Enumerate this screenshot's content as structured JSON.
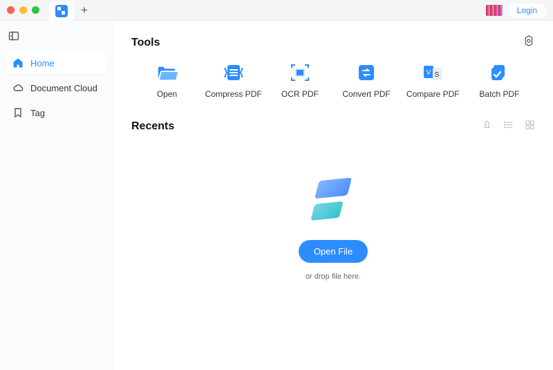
{
  "titlebar": {
    "login_label": "Login"
  },
  "sidebar": {
    "items": [
      {
        "label": "Home"
      },
      {
        "label": "Document Cloud"
      },
      {
        "label": "Tag"
      }
    ]
  },
  "sections": {
    "tools_title": "Tools",
    "recents_title": "Recents"
  },
  "tools": [
    {
      "label": "Open"
    },
    {
      "label": "Compress PDF"
    },
    {
      "label": "OCR PDF"
    },
    {
      "label": "Convert PDF"
    },
    {
      "label": "Compare PDF"
    },
    {
      "label": "Batch PDF"
    }
  ],
  "empty_state": {
    "open_button": "Open File",
    "hint": "or drop file here."
  }
}
